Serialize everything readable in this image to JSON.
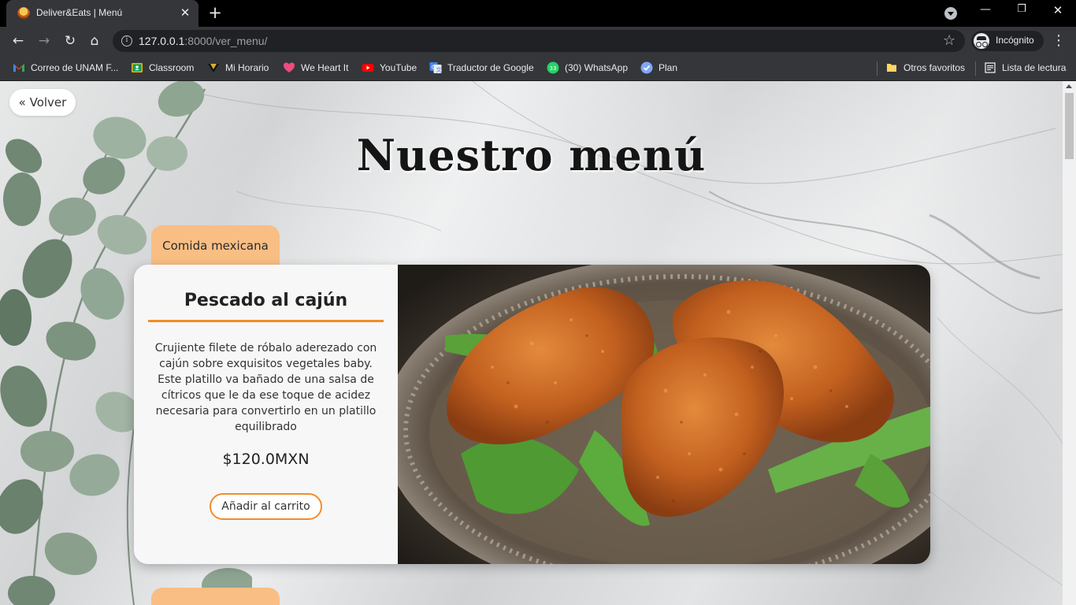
{
  "browser": {
    "tab_title": "Deliver&Eats | Menú",
    "url_host": "127.0.0.1",
    "url_path": ":8000/ver_menu/",
    "profile_label": "Incógnito",
    "bookmarks": [
      {
        "label": "Correo de UNAM F...",
        "icon": "gmail-icon"
      },
      {
        "label": "Classroom",
        "icon": "classroom-icon"
      },
      {
        "label": "Mi Horario",
        "icon": "horario-icon"
      },
      {
        "label": "We Heart It",
        "icon": "heart-icon"
      },
      {
        "label": "YouTube",
        "icon": "youtube-icon"
      },
      {
        "label": "Traductor de Google",
        "icon": "translate-icon"
      },
      {
        "label": "(30) WhatsApp",
        "icon": "whatsapp-icon",
        "badge": "33"
      },
      {
        "label": "Plan",
        "icon": "plan-icon"
      }
    ],
    "other_bookmarks": "Otros favoritos",
    "reading_list": "Lista de lectura"
  },
  "page": {
    "back_label": "« Volver",
    "title": "Nuestro menú",
    "category": "Comida mexicana",
    "dish": {
      "name": "Pescado al cajún",
      "description": "Crujiente filete de róbalo aderezado con cajún sobre exquisitos vegetales baby. Este platillo va bañado de una salsa de cítricos que le da ese toque de acidez necesaria para convertirlo en un platillo equilibrado",
      "price": "$120.0MXN",
      "add_to_cart": "Añadir al carrito"
    }
  },
  "colors": {
    "accent": "#f28c28",
    "tab_peach": "#f9be84"
  }
}
